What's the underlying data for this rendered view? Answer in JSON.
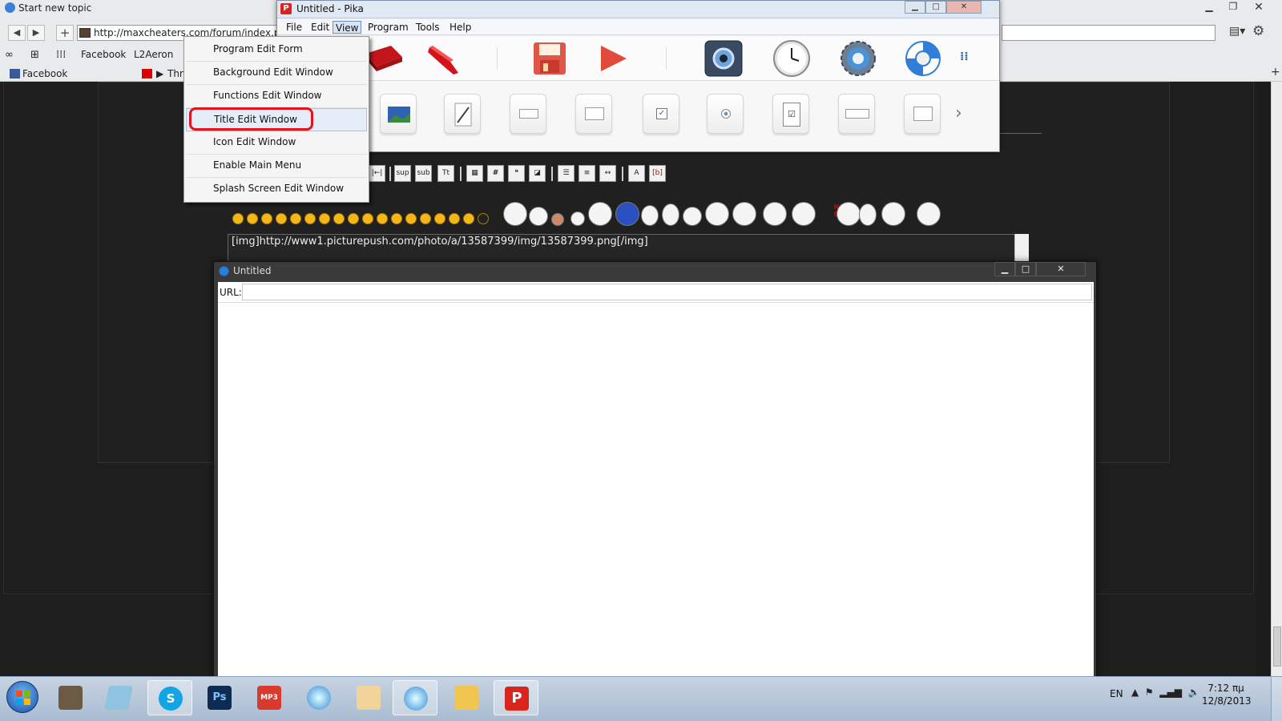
{
  "browser": {
    "title": "Start new topic",
    "address": "http://maxcheaters.com/forum/index.php?",
    "bookmarks": [
      "Facebook",
      "L2Aeron"
    ],
    "tabs": [
      "Facebook",
      "Thr"
    ]
  },
  "forum": {
    "bbcode_text": "[img]http://www1.picturepush.com/photo/a/13587399/img/13587399.png[/img]",
    "editor_buttons": [
      "sup",
      "sub",
      "Tt",
      "#"
    ],
    "not_bad_label": "NOT BAD"
  },
  "pika": {
    "title": "Untitled - Pika",
    "menus": [
      "File",
      "Edit",
      "View",
      "Program",
      "Tools",
      "Help"
    ],
    "active_menu": "View",
    "view_menu_items": [
      "Program Edit Form",
      "Background Edit Window",
      "Functions Edit Window",
      "Title Edit Window",
      "Icon Edit Window",
      "Enable Main Menu",
      "Splash Screen Edit Window"
    ],
    "highlighted_item": "Title Edit Window",
    "toolbar_icons": [
      "folder-icon",
      "scissors-icon",
      "save-icon",
      "play-icon",
      "settings-app-icon",
      "clock-icon",
      "gear-icon",
      "lifebuoy-icon"
    ],
    "widget_icons": [
      "image-widget-icon",
      "pen-widget-icon",
      "textbox-widget-icon",
      "panel-widget-icon",
      "checkbox-widget-icon",
      "radio-widget-icon",
      "checklist-widget-icon",
      "combobox-widget-icon",
      "spinner-widget-icon"
    ]
  },
  "untitled": {
    "title": "Untitled",
    "url_label": "URL:",
    "url_value": ""
  },
  "taskbar": {
    "language": "EN",
    "time": "7:12 πμ",
    "date": "12/8/2013",
    "apps": [
      "lineage-icon",
      "notes-icon",
      "skype-icon",
      "photoshop-icon",
      "mp3-icon",
      "safari-icon",
      "anime-icon",
      "safari-icon-2",
      "explorer-icon",
      "pika-icon"
    ]
  },
  "colors": {
    "highlight_ring": "#e0141e",
    "pika_red": "#d9251d",
    "forum_background": "#1e1e1e",
    "taskbar": "#b7c7db"
  }
}
